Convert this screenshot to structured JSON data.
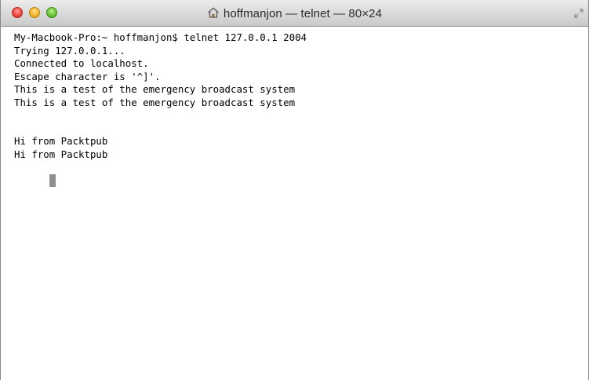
{
  "window": {
    "title": "hoffmanjon — telnet — 80×24",
    "title_icon": "home-icon",
    "buttons": {
      "close_color": "#ee4b40",
      "minimize_color": "#f4b52b",
      "zoom_color": "#6cc43a"
    }
  },
  "terminal": {
    "lines": [
      "My-Macbook-Pro:~ hoffmanjon$ telnet 127.0.0.1 2004",
      "Trying 127.0.0.1...",
      "Connected to localhost.",
      "Escape character is '^]'.",
      "This is a test of the emergency broadcast system",
      "This is a test of the emergency broadcast system",
      "",
      "",
      "Hi from Packtpub",
      "Hi from Packtpub"
    ],
    "text_color": "#000000",
    "background_color": "#ffffff",
    "cursor_color": "#8e8e8e"
  }
}
